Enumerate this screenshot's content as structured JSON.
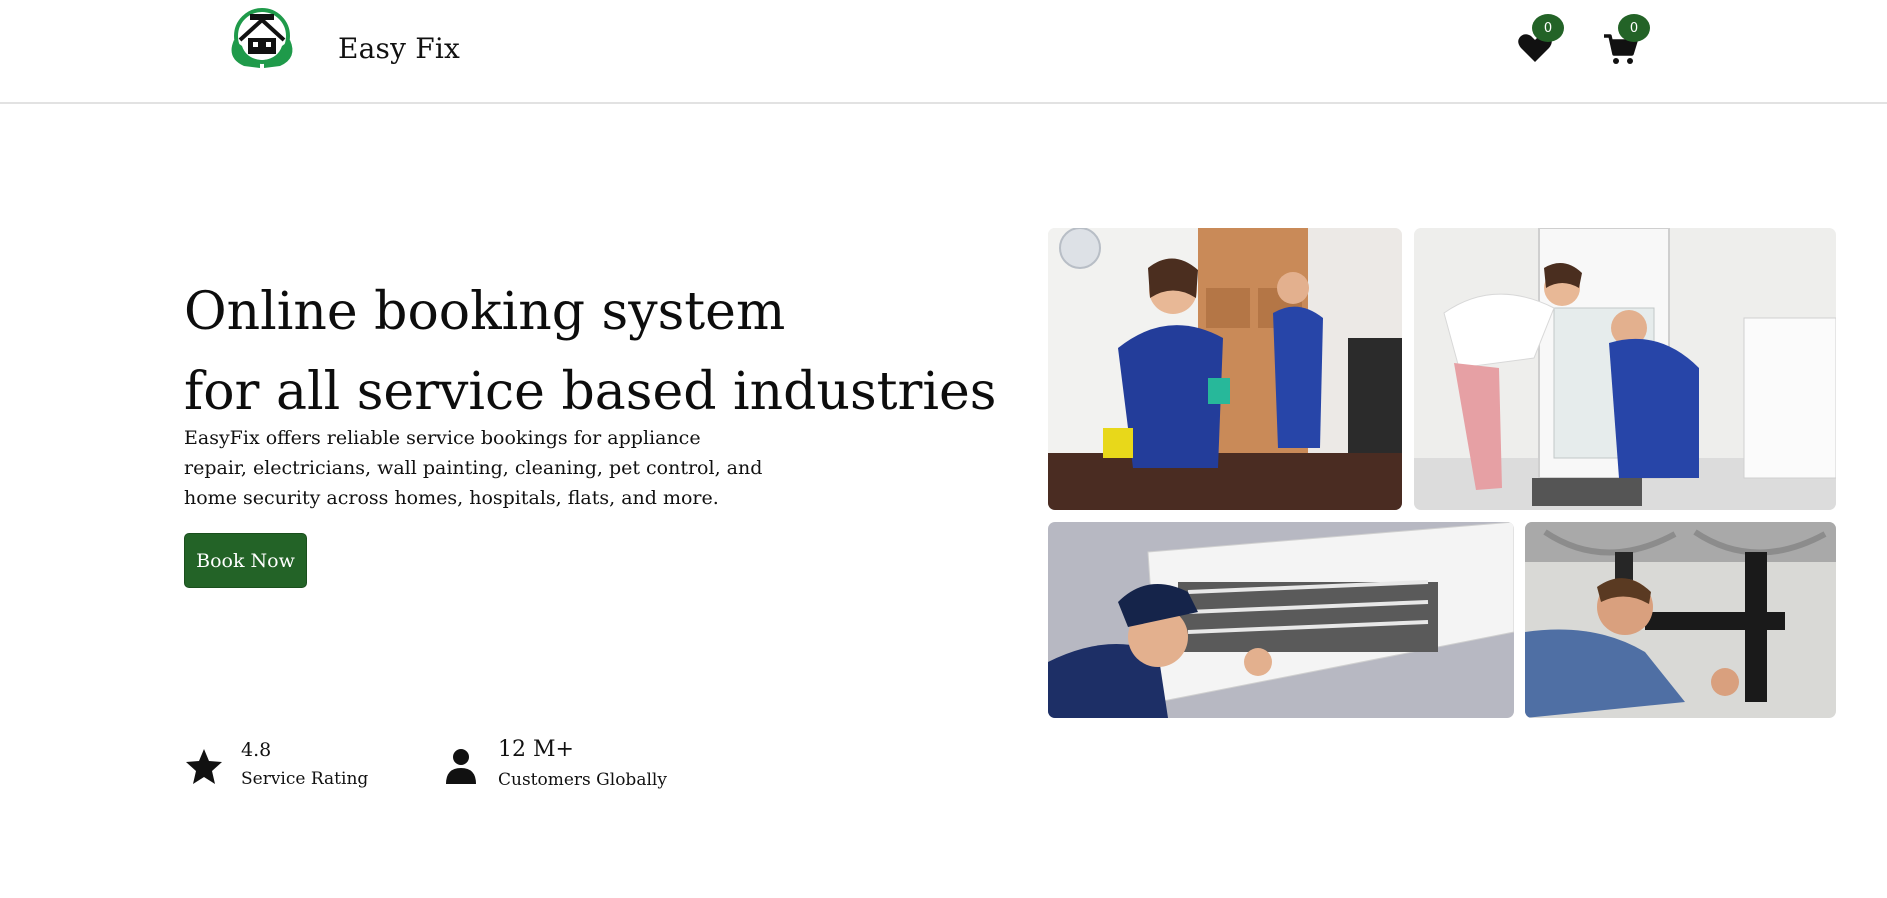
{
  "header": {
    "brand": "Easy Fix",
    "wishlist_count": "0",
    "cart_count": "0",
    "logo_icon": "house-hands-logo",
    "wishlist_icon": "heart-icon",
    "cart_icon": "cart-icon"
  },
  "hero": {
    "title_line1": "Online booking system",
    "title_line2": "for all service based industries",
    "description": "EasyFix offers reliable service bookings for appliance repair, electricians, wall painting, cleaning, pet control, and home security across homes, hospitals, flats, and more.",
    "cta_label": "Book Now"
  },
  "stats": [
    {
      "icon": "star-icon",
      "value": "4.8",
      "label": "Service Rating"
    },
    {
      "icon": "user-icon",
      "value": "12 M+",
      "label": "Customers Globally"
    }
  ],
  "gallery": [
    {
      "subject": "cleaning"
    },
    {
      "subject": "refrigerator-repair"
    },
    {
      "subject": "ac-repair"
    },
    {
      "subject": "plumbing"
    }
  ],
  "colors": {
    "accent": "#236327",
    "logo_green": "#1f9a4a",
    "header_border": "#e2e2e2"
  }
}
